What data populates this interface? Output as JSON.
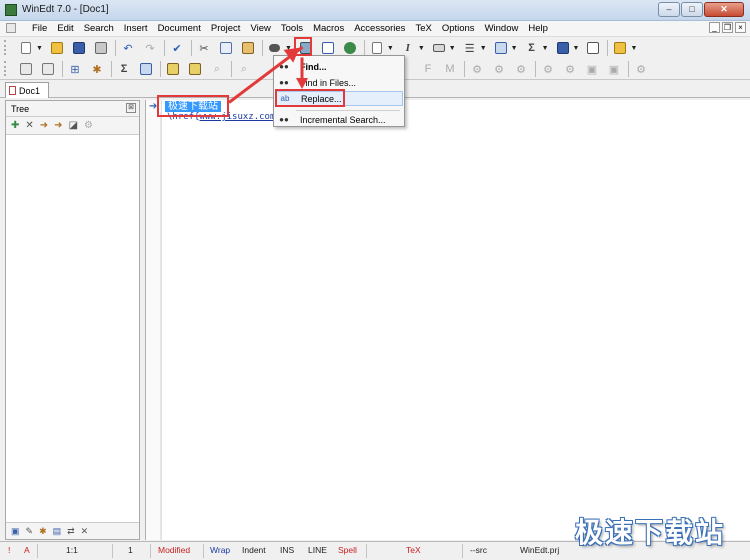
{
  "window": {
    "title": "WinEdt 7.0 - [Doc1]",
    "controls": [
      "–",
      "□",
      "✕"
    ]
  },
  "menubar": {
    "items": [
      "File",
      "Edit",
      "Search",
      "Insert",
      "Document",
      "Project",
      "View",
      "Tools",
      "Macros",
      "Accessories",
      "TeX",
      "Options",
      "Window",
      "Help"
    ]
  },
  "tabs": [
    {
      "label": "Doc1"
    }
  ],
  "tree": {
    "title": "Tree"
  },
  "editor": {
    "line1": "极速下载站",
    "line2_prefix": "\\href{",
    "line2_link": "www.jisuxz.com"
  },
  "search_menu": {
    "items": [
      {
        "label": "Find...",
        "icon": "binoculars-icon"
      },
      {
        "label": "Find in Files...",
        "icon": "binoculars-files-icon"
      },
      {
        "label": "Replace...",
        "icon": "replace-icon",
        "highlighted": true
      },
      {
        "label": "Incremental Search...",
        "icon": "incremental-search-icon"
      }
    ]
  },
  "statusbar": {
    "error_marker": "!",
    "mode_marker": "A",
    "position": "1:1",
    "line_count": "1",
    "modified": "Modified",
    "wrap": "Wrap",
    "indent": "Indent",
    "ins": "INS",
    "line": "LINE",
    "spell": "Spell",
    "tex": "TeX",
    "src": "--src",
    "project": "WinEdt.prj"
  },
  "watermark": "极速下载站",
  "annotation_color": "#e23a3a"
}
